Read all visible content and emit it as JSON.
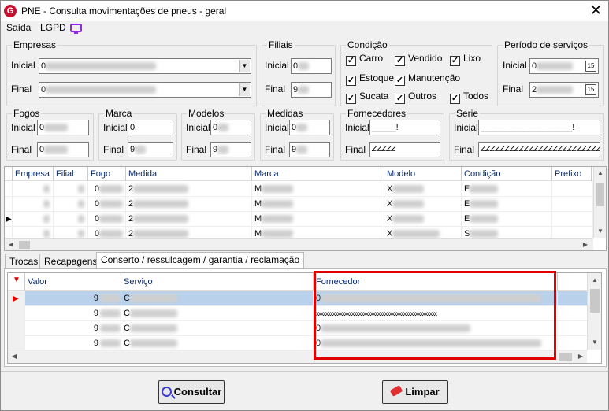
{
  "window": {
    "title": "PNE - Consulta movimentações de pneus - geral",
    "logo_letter": "G",
    "close_glyph": "✕"
  },
  "menu": {
    "items": [
      "Saída",
      "LGPD"
    ]
  },
  "empresas": {
    "title": "Empresas",
    "inicial_label": "Inicial",
    "final_label": "Final",
    "inicial_value": "0",
    "final_value": "0"
  },
  "filiais": {
    "title": "Filiais",
    "inicial_label": "Inicial",
    "final_label": "Final",
    "inicial_value": "0",
    "final_value": "9"
  },
  "condicao": {
    "title": "Condição",
    "checks": [
      "Carro",
      "Vendido",
      "Lixo",
      "Estoque",
      "Manutenção",
      "Sucata",
      "Outros",
      "Todos"
    ],
    "check_mark": "✓"
  },
  "periodo": {
    "title": "Período de serviços",
    "inicial_label": "Inicial",
    "final_label": "Final",
    "inicial_value": "0",
    "final_value": "2",
    "cal_label": "15"
  },
  "fogos": {
    "title": "Fogos",
    "inicial_label": "Inicial",
    "final_label": "Final",
    "inicial_value": "0",
    "final_value": "0"
  },
  "marca": {
    "title": "Marca",
    "inicial_label": "Inicial",
    "final_label": "Final",
    "inicial_value": "0",
    "final_value": "9"
  },
  "modelos": {
    "title": "Modelos",
    "inicial_label": "Inicial",
    "final_label": "Final",
    "inicial_value": "0",
    "final_value": "9"
  },
  "medidas": {
    "title": "Medidas",
    "inicial_label": "Inicial",
    "final_label": "Final",
    "inicial_value": "0",
    "final_value": "9"
  },
  "fornecedores": {
    "title": "Fornecedores",
    "inicial_label": "Inicial",
    "final_label": "Final",
    "inicial_value": "_____!",
    "final_value": "ZZZZZ"
  },
  "serie": {
    "title": "Serie",
    "inicial_label": "Inicial",
    "final_label": "Final",
    "inicial_value": "___________________!",
    "final_value": "ZZZZZZZZZZZZZZZZZZZZZZZZZZZZZ"
  },
  "main_grid": {
    "headers": [
      "Empresa",
      "Filial",
      "Fogo",
      "Medida",
      "Marca",
      "Modelo",
      "Condição",
      "Prefixo"
    ],
    "rows": [
      {
        "fogo": "0",
        "medida": "2",
        "marca": "M",
        "modelo": "X",
        "condicao": "E"
      },
      {
        "fogo": "0",
        "medida": "2",
        "marca": "M",
        "modelo": "X",
        "condicao": "E"
      },
      {
        "fogo": "0",
        "medida": "2",
        "marca": "M",
        "modelo": "X",
        "condicao": "E"
      },
      {
        "fogo": "0",
        "medida": "2",
        "marca": "M",
        "modelo": "X",
        "condicao": "S"
      }
    ],
    "current_row_marker": "▶"
  },
  "tabs": [
    "Trocas",
    "Recapagens",
    "Conserto / ressulcagem / garantia / reclamação"
  ],
  "detail_grid": {
    "headers": [
      "Valor",
      "Serviço",
      "Fornecedor"
    ],
    "sort_marker": "▼",
    "current_row_marker": "▶",
    "rows": [
      {
        "valor": "9",
        "servico": "C",
        "fornecedor": "0"
      },
      {
        "valor": "9",
        "servico": "C",
        "fornecedor": "xxxxxxxxxxxxxxxxxxxxxxxxxxxxxxxxxxxxxxxxxxxxxxxxxxx"
      },
      {
        "valor": "9",
        "servico": "C",
        "fornecedor": "0"
      },
      {
        "valor": "9",
        "servico": "C",
        "fornecedor": "0"
      }
    ]
  },
  "buttons": {
    "consultar": "Consultar",
    "limpar": "Limpar"
  },
  "colors": {
    "highlight": "#e00000",
    "selected_row": "#b9d1ea",
    "grid_header": "#0a2a6a",
    "accent": "#c8102e",
    "lgpd_icon": "#8a2be2"
  }
}
